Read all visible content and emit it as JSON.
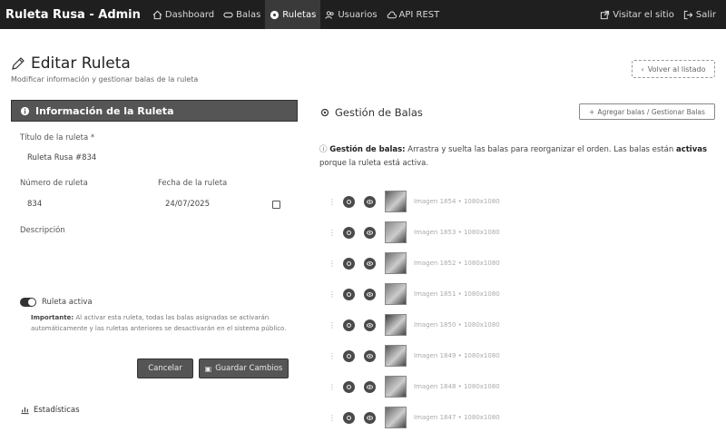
{
  "nav": {
    "brand": "Ruleta Rusa - Admin",
    "items": [
      {
        "label": "Dashboard",
        "icon": "home-icon",
        "active": false
      },
      {
        "label": "Balas",
        "icon": "bullet-icon",
        "active": false
      },
      {
        "label": "Ruletas",
        "icon": "roulette-icon",
        "active": true
      },
      {
        "label": "Usuarios",
        "icon": "users-icon",
        "active": false
      },
      {
        "label": "API REST",
        "icon": "cloud-icon",
        "active": false
      }
    ],
    "right_items": [
      {
        "label": "Visitar el sitio",
        "icon": "external-link-icon"
      },
      {
        "label": "Salir",
        "icon": "logout-icon"
      }
    ]
  },
  "header": {
    "title": "Editar Ruleta",
    "subtitle": "Modificar información y gestionar balas de la ruleta",
    "back_label": "Volver al listado"
  },
  "form": {
    "card_title": "Información de la Ruleta",
    "title_label": "Título de la ruleta *",
    "title_value": "Ruleta Rusa #834",
    "number_label": "Número de ruleta",
    "number_value": "834",
    "date_label": "Fecha de la ruleta",
    "date_value": "24/07/2025",
    "description_label": "Descripción",
    "active_label": "Ruleta activa",
    "note_bold": "Importante:",
    "note_text": "Al activar esta ruleta, todas las balas asignadas se activarán automáticamente y las ruletas anteriores se desactivarán en el sistema público.",
    "cancel_label": "Cancelar",
    "save_label": "Guardar Cambios",
    "stats_label": "Estadísticas"
  },
  "bullets_panel": {
    "title": "Gestión de Balas",
    "add_label": "Agregar balas / Gestionar Balas",
    "info_bold": "Gestión de balas:",
    "info_text": "Arrastra y suelta las balas para reorganizar el orden. Las balas están",
    "info_active": "activas",
    "info_tail": "porque la ruleta está activa.",
    "items": [
      {
        "label": "Imagen 1854 • 1080x1080"
      },
      {
        "label": "Imagen 1853 • 1080x1080"
      },
      {
        "label": "Imagen 1852 • 1080x1080"
      },
      {
        "label": "Imagen 1851 • 1080x1080"
      },
      {
        "label": "Imagen 1850 • 1080x1080"
      },
      {
        "label": "Imagen 1849 • 1080x1080"
      },
      {
        "label": "Imagen 1848 • 1080x1080"
      },
      {
        "label": "Imagen 1847 • 1080x1080"
      }
    ]
  },
  "colors": {
    "topbar": "#1f1f1f",
    "card_header": "#555555",
    "button_dark": "#555555"
  }
}
